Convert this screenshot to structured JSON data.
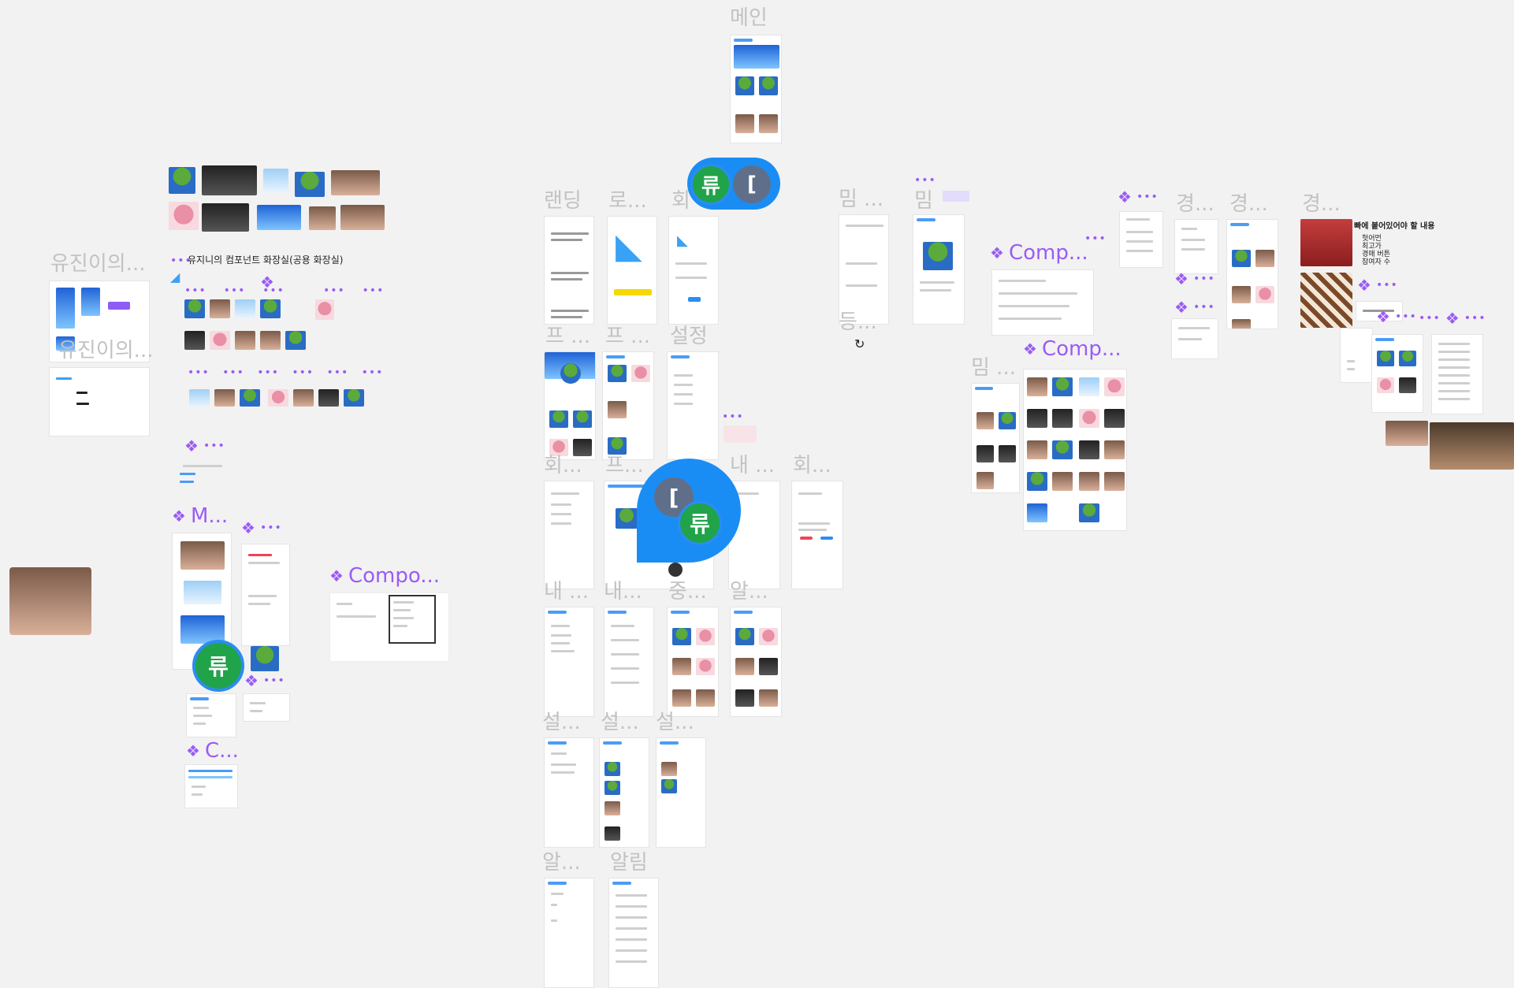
{
  "canvas": {
    "background": "#f2f2f2",
    "accent_purple": "#9a5cf5",
    "accent_blue": "#2b8df0",
    "avatar_green": "#21a34a"
  },
  "frame_labels": {
    "main": "메인",
    "landing": "랜딩",
    "login": "로...",
    "signup_short": "회",
    "meme1": "밈 ...",
    "meme2": "밈",
    "auction1": "경...",
    "auction2": "경...",
    "auction3": "경...",
    "profile1": "프 ...",
    "profile2": "프 ...",
    "settings": "설정",
    "register": "등...",
    "meme3": "밈 ...",
    "member1": "회...",
    "profile3": "프...",
    "mine1": "내 ...",
    "member2": "회...",
    "mine2": "내 ...",
    "mine3": "내...",
    "middle": "중...",
    "alarm1": "알...",
    "setting1": "설...",
    "setting2": "설...",
    "setting3": "설...",
    "alarm2": "알...",
    "alarm3": "알림",
    "yujin1": "유진이의...",
    "yujin2": "유진이의..."
  },
  "components": {
    "comp1": "Comp...",
    "comp2": "Comp...",
    "m": "M...",
    "compo": "Compo...",
    "c": "C..."
  },
  "annotations": {
    "restroom_title": "유지니의 컴포넌트 화장실(공용 화장실)",
    "memo_title": "빠에 붙어있어야 할 내용",
    "memo_lines": [
      "헛어먼",
      "최고가",
      "경매 버튼",
      "참여자 수"
    ]
  },
  "cursors": {
    "avatar_top_green": "류",
    "avatar_top_gray": "[",
    "avatar_mid_gray": "[",
    "avatar_mid_green": "류",
    "avatar_left_green": "류"
  },
  "icons": [
    "component-diamond-icon",
    "more-dots-icon",
    "rabbit-logo-icon",
    "refresh-icon",
    "cursor-avatar-icon"
  ]
}
